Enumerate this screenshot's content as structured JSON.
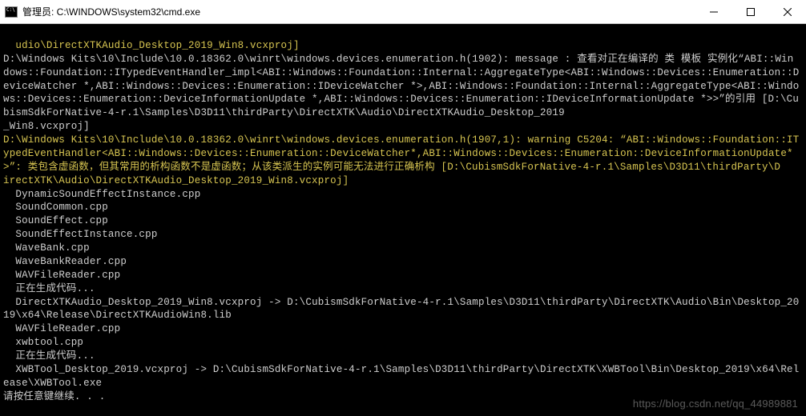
{
  "titlebar": {
    "title": "管理员: C:\\WINDOWS\\system32\\cmd.exe",
    "icon_name": "cmd-icon"
  },
  "lines": [
    {
      "cls": "y",
      "text": "udio\\DirectXTKAudio_Desktop_2019_Win8.vcxproj]"
    },
    {
      "cls": "w",
      "text": "D:\\Windows Kits\\10\\Include\\10.0.18362.0\\winrt\\windows.devices.enumeration.h(1902): message : 查看对正在编译的 类 模板 实例化“ABI::Win"
    },
    {
      "cls": "w",
      "text": "dows::Foundation::ITypedEventHandler_impl<ABI::Windows::Foundation::Internal::AggregateType<ABI::Windows::Devices::Enumeration::DeviceWatcher *,ABI::Windows::Devices::Enumeration::IDeviceWatcher *>,ABI::Windows::Foundation::Internal::AggregateType<ABI::Windows::Devices::Enumeration::DeviceInformationUpdate *,ABI::Windows::Devices::Enumeration::IDeviceInformationUpdate *>>”的引用 [D:\\CubismSdkForNative-4-r.1\\Samples\\D3D11\\thirdParty\\DirectXTK\\Audio\\DirectXTKAudio_Desktop_2019"
    },
    {
      "cls": "w",
      "text": "_Win8.vcxproj]"
    },
    {
      "cls": "y",
      "text": "D:\\Windows Kits\\10\\Include\\10.0.18362.0\\winrt\\windows.devices.enumeration.h(1907,1): warning C5204: “ABI::Windows::Foundation::ITypedEventHandler<ABI::Windows::Devices::Enumeration::DeviceWatcher*,ABI::Windows::Devices::Enumeration::DeviceInformationUpdate*>”: 类包含虚函数，但其常用的析构函数不是虚函数；从该类派生的实例可能无法进行正确析构 [D:\\CubismSdkForNative-4-r.1\\Samples\\D3D11\\thirdParty\\D"
    },
    {
      "cls": "y",
      "text": "irectXTK\\Audio\\DirectXTKAudio_Desktop_2019_Win8.vcxproj]"
    },
    {
      "cls": "w",
      "text": "  DynamicSoundEffectInstance.cpp"
    },
    {
      "cls": "w",
      "text": "  SoundCommon.cpp"
    },
    {
      "cls": "w",
      "text": "  SoundEffect.cpp"
    },
    {
      "cls": "w",
      "text": "  SoundEffectInstance.cpp"
    },
    {
      "cls": "w",
      "text": "  WaveBank.cpp"
    },
    {
      "cls": "w",
      "text": "  WaveBankReader.cpp"
    },
    {
      "cls": "w",
      "text": "  WAVFileReader.cpp"
    },
    {
      "cls": "w",
      "text": "  正在生成代码..."
    },
    {
      "cls": "w",
      "text": "  DirectXTKAudio_Desktop_2019_Win8.vcxproj -> D:\\CubismSdkForNative-4-r.1\\Samples\\D3D11\\thirdParty\\DirectXTK\\Audio\\Bin\\Desktop_2019\\x64\\Release\\DirectXTKAudioWin8.lib"
    },
    {
      "cls": "w",
      "text": "  WAVFileReader.cpp"
    },
    {
      "cls": "w",
      "text": "  xwbtool.cpp"
    },
    {
      "cls": "w",
      "text": "  正在生成代码..."
    },
    {
      "cls": "w",
      "text": "  XWBTool_Desktop_2019.vcxproj -> D:\\CubismSdkForNative-4-r.1\\Samples\\D3D11\\thirdParty\\DirectXTK\\XWBTool\\Bin\\Desktop_2019\\x64\\Release\\XWBTool.exe"
    },
    {
      "cls": "w",
      "text": "请按任意键继续. . ."
    }
  ],
  "watermark": "https://blog.csdn.net/qq_44989881"
}
